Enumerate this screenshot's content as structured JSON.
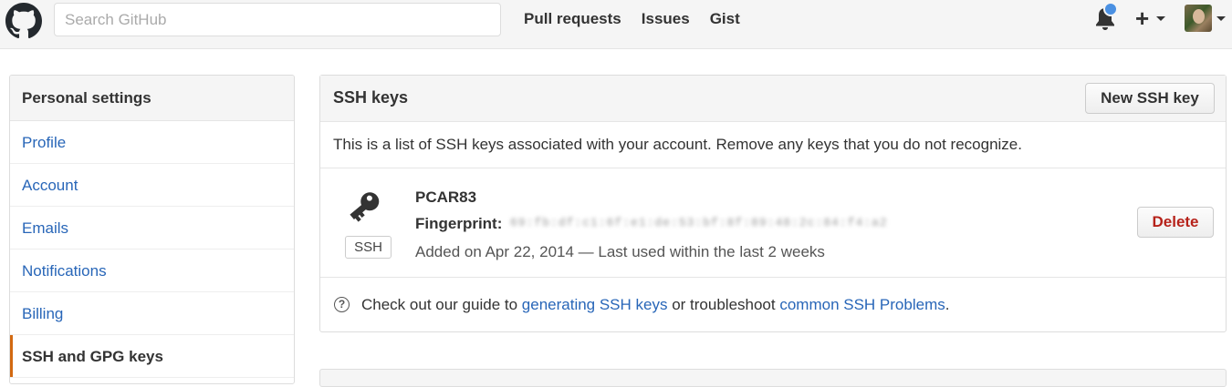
{
  "header": {
    "search_placeholder": "Search GitHub",
    "nav": [
      "Pull requests",
      "Issues",
      "Gist"
    ],
    "new_icon": "plus-icon",
    "notification_icon": "bell-icon"
  },
  "sidebar": {
    "title": "Personal settings",
    "items": [
      {
        "label": "Profile"
      },
      {
        "label": "Account"
      },
      {
        "label": "Emails"
      },
      {
        "label": "Notifications"
      },
      {
        "label": "Billing"
      },
      {
        "label": "SSH and GPG keys",
        "selected": true
      }
    ]
  },
  "ssh_panel": {
    "title": "SSH keys",
    "new_button": "New SSH key",
    "intro": "This is a list of SSH keys associated with your account. Remove any keys that you do not recognize.",
    "key": {
      "name": "PCAR83",
      "badge": "SSH",
      "fingerprint_label": "Fingerprint:",
      "fingerprint_value": "69:fb:df:c1:6f:e1:de:53:bf:8f:89:48:2c:84:f4:a2",
      "meta": "Added on Apr 22, 2014 — Last used within the last 2 weeks",
      "delete_button": "Delete"
    },
    "footer": {
      "help_glyph": "?",
      "prefix": "Check out our guide to ",
      "link1": "generating SSH keys",
      "middle": " or troubleshoot ",
      "link2": "common SSH Problems",
      "suffix": "."
    }
  },
  "colors": {
    "link": "#2866b8",
    "accent": "#d26911",
    "danger": "#b6221a",
    "notification": "#4a90e2"
  }
}
